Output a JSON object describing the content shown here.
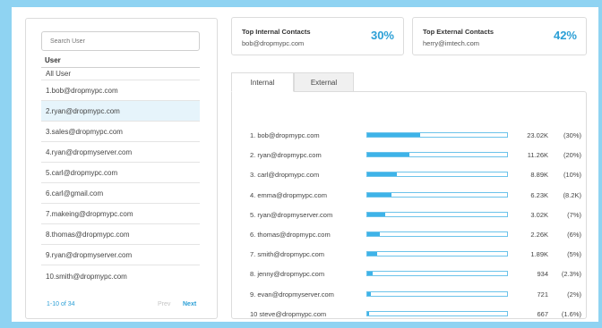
{
  "search": {
    "placeholder": "Search User"
  },
  "users": {
    "header": "User",
    "all_label": "All User",
    "items": [
      "1.bob@dropmypc.com",
      "2.ryan@dropmypc.com",
      "3.sales@dropmypc.com",
      "4.ryan@dropmyserver.com",
      "5.carl@dropmypc.com",
      "6.carl@gmail.com",
      "7.makeing@dropmypc.com",
      "8.thomas@dropmypc.com",
      "9.ryan@dropmyserver.com",
      "10.smith@dropmypc.com"
    ],
    "selected_index": 1
  },
  "pager": {
    "range": "1-10 of 34",
    "prev": "Prev",
    "next": "Next"
  },
  "top_internal": {
    "title": "Top Internal Contacts",
    "email": "bob@dropmypc.com",
    "percent": "30%"
  },
  "top_external": {
    "title": "Top External Contacts",
    "email": "herry@imtech.com",
    "percent": "42%"
  },
  "tabs": {
    "internal": "Internal",
    "external": "External",
    "active": "internal"
  },
  "contacts": [
    {
      "name": "1. bob@dropmypc.com",
      "value": "23.02K",
      "percent": "(30%)",
      "level": 0.38
    },
    {
      "name": "2. ryan@dropmypc.com",
      "value": "11.26K",
      "percent": "(20%)",
      "level": 0.3
    },
    {
      "name": "3. carl@dropmypc.com",
      "value": "8.89K",
      "percent": "(10%)",
      "level": 0.21
    },
    {
      "name": "4. emma@dropmypc.com",
      "value": "6.23K",
      "percent": "(8.2K)",
      "level": 0.17
    },
    {
      "name": "5. ryan@dropmyserver.com",
      "value": "3.02K",
      "percent": "(7%)",
      "level": 0.13
    },
    {
      "name": "6. thomas@dropmypc.com",
      "value": "2.26K",
      "percent": "(6%)",
      "level": 0.09
    },
    {
      "name": "7. smith@dropmypc.com",
      "value": "1.89K",
      "percent": "(5%)",
      "level": 0.07
    },
    {
      "name": "8. jenny@dropmypc.com",
      "value": "934",
      "percent": "(2.3%)",
      "level": 0.04
    },
    {
      "name": "9. evan@dropmyserver.com",
      "value": "721",
      "percent": "(2%)",
      "level": 0.025
    },
    {
      "name": "10 steve@dropmypc.com",
      "value": "667",
      "percent": "(1.6%)",
      "level": 0.015
    }
  ],
  "colors": {
    "accent": "#2b9fd6",
    "bar_fill": "#3eb3e8",
    "selected_bg": "#e6f4fb",
    "page_bg": "#8fd3f2"
  }
}
